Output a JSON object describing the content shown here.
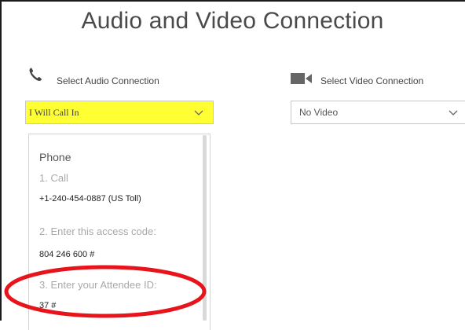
{
  "title": "Audio and Video Connection",
  "audio": {
    "label": "Select Audio Connection",
    "icon": "phone-icon",
    "selected": "I Will Call In",
    "highlight_color": "#ffff33"
  },
  "video": {
    "label": "Select Video Connection",
    "icon": "video-camera-icon",
    "selected": "No Video"
  },
  "phone_panel": {
    "heading": "Phone",
    "steps": [
      {
        "label": "1. Call",
        "value": "+1-240-454-0887 (US Toll)"
      },
      {
        "label": "2. Enter this access code:",
        "value": "804 246 600 #"
      },
      {
        "label": "3. Enter your Attendee ID:",
        "value": "37 #"
      }
    ]
  },
  "annotation_color": "#e8141c"
}
